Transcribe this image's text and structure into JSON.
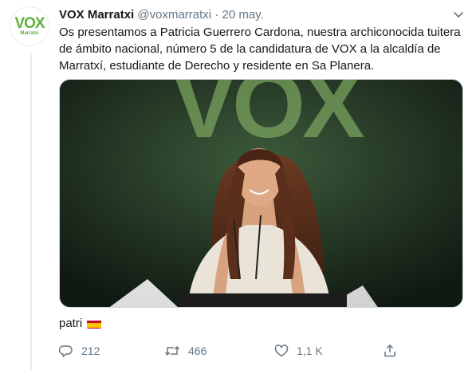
{
  "tweet": {
    "avatar": {
      "logo_text": "VOX",
      "sub_text": "Marratxí"
    },
    "author_name": "VOX Marratxi",
    "handle": "@voxmarratxi",
    "separator": "·",
    "date": "20 may.",
    "text": "Os presentamos a Patricia Guerrero Cardona, nuestra archiconocida tuitera de ámbito nacional, número 5 de la candidatura de VOX a la alcaldía de Marratxí, estudiante de Derecho y residente en Sa Planera.",
    "image_backdrop_text": "VOX",
    "caption": "patri",
    "caption_flag": "spain-flag-icon",
    "actions": {
      "reply_count": "212",
      "retweet_count": "466",
      "like_count": "1,1 K"
    }
  },
  "colors": {
    "accent_green": "#5eb13b",
    "muted_text": "#657786",
    "border": "#e6ecf0"
  }
}
